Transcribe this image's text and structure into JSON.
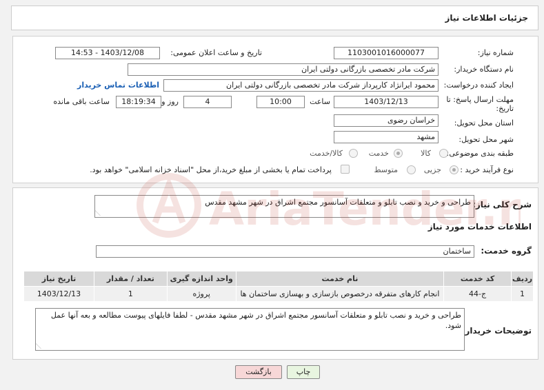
{
  "header": {
    "title": "جزئیات اطلاعات نیاز"
  },
  "form": {
    "need_number_label": "شماره نیاز:",
    "need_number": "1103001016000077",
    "announce_label": "تاریخ و ساعت اعلان عمومی:",
    "announce_value": "1403/12/08 - 14:53",
    "buyer_org_label": "نام دستگاه خریدار:",
    "buyer_org": "شرکت مادر تخصصی بازرگانی دولتی ایران",
    "creator_label": "ایجاد کننده درخواست:",
    "creator": "محمود ایرانژاد کارپرداز شرکت مادر تخصصی بازرگانی دولتی ایران",
    "contact_link": "اطلاعات تماس خریدار",
    "deadline_label_1": "مهلت ارسال پاسخ: تا",
    "deadline_label_2": "تاریخ:",
    "deadline_date": "1403/12/13",
    "time_label": "ساعت",
    "deadline_time": "10:00",
    "days": "4",
    "days_label": "روز و",
    "remaining_time": "18:19:34",
    "remaining_label": "ساعت باقی مانده",
    "province_label": "استان محل تحویل:",
    "province": "خراسان رضوی",
    "city_label": "شهر محل تحویل:",
    "city": "مشهد",
    "category_label": "طبقه بندی موضوعی:",
    "category_options": [
      "کالا",
      "خدمت",
      "کالا/خدمت"
    ],
    "category_selected": "خدمت",
    "process_label": "نوع فرآیند خرید :",
    "process_options": [
      "جزیی",
      "متوسط"
    ],
    "process_selected": "جزیی",
    "treasury_note": "پرداخت تمام یا بخشی از مبلغ خرید،از محل \"اسناد خزانه اسلامی\" خواهد بود."
  },
  "summary": {
    "label": "شرح کلی نیاز:",
    "text": "طراحی و خرید و نصب تابلو و متعلقات آسانسور مجتمع اشراق در شهر مشهد مقدس"
  },
  "services": {
    "section_title": "اطلاعات خدمات مورد نیاز",
    "group_label": "گروه خدمت:",
    "group_value": "ساختمان",
    "columns": [
      "ردیف",
      "کد خدمت",
      "نام خدمت",
      "واحد اندازه گیری",
      "تعداد / مقدار",
      "تاریخ نیاز"
    ],
    "rows": [
      [
        "1",
        "ج-44",
        "انجام کارهای متفرقه درخصوص بازسازی و بهسازی ساختمان ها",
        "پروژه",
        "1",
        "1403/12/13"
      ]
    ]
  },
  "buyer_notes": {
    "label": "توضیحات خریدار:",
    "text": "طراحی و خرید و نصب تابلو و متعلقات آسانسور مجتمع اشراق در شهر مشهد مقدس - لطفا فایلهای پیوست مطالعه و بعه آنها عمل شود."
  },
  "buttons": {
    "print": "چاپ",
    "back": "بازگشت"
  },
  "watermark": {
    "text": "AriaTender.neT"
  },
  "colors": {
    "link": "#1a5fb4",
    "back_button_bg": "#f7d7d7",
    "print_button_bg": "#e8f5e0",
    "watermark": "#c0392b"
  }
}
